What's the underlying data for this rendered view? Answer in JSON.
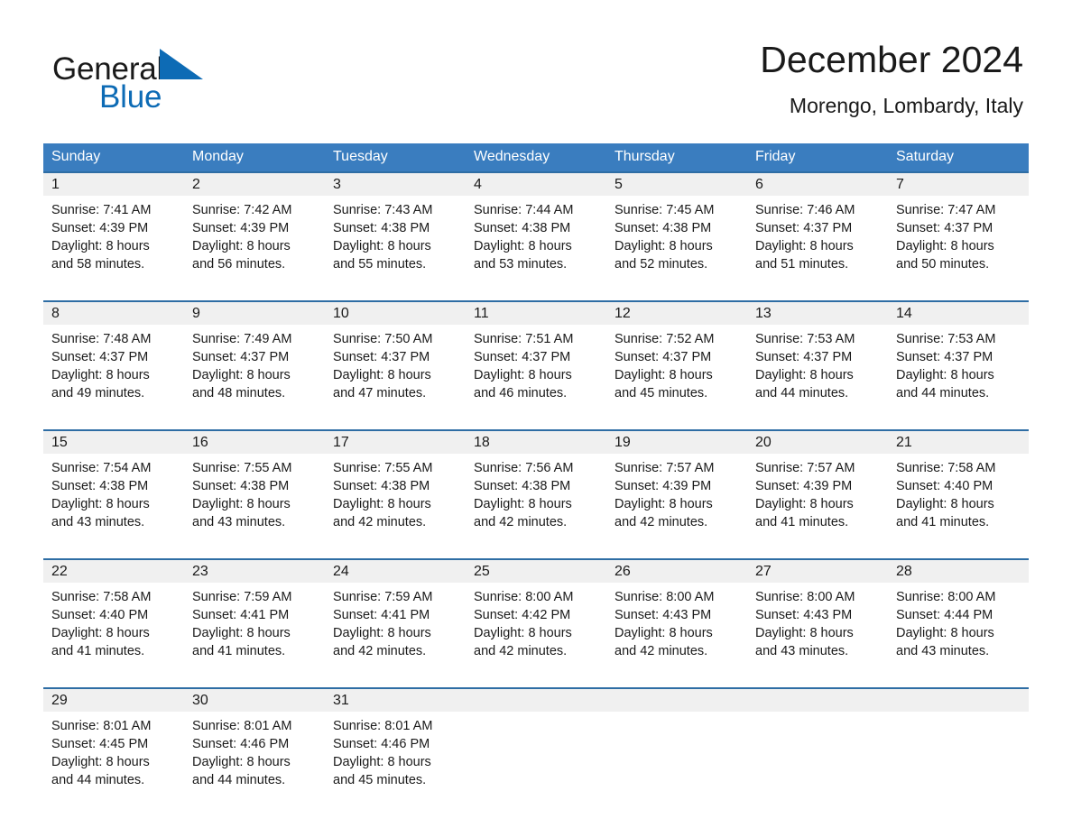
{
  "brand": {
    "name_part1": "General",
    "name_part2": "Blue",
    "triangle_color": "#0d6bb5",
    "text_color": "#1a1a1a"
  },
  "header": {
    "title": "December 2024",
    "subtitle": "Morengo, Lombardy, Italy"
  },
  "theme": {
    "header_bg": "#3a7dbf",
    "header_text": "#ffffff",
    "row_border": "#2e6da4",
    "daynum_bg": "#f0f0f0",
    "body_text": "#1a1a1a",
    "page_bg": "#ffffff"
  },
  "weekdays": [
    "Sunday",
    "Monday",
    "Tuesday",
    "Wednesday",
    "Thursday",
    "Friday",
    "Saturday"
  ],
  "labels": {
    "sunrise_prefix": "Sunrise:",
    "sunset_prefix": "Sunset:",
    "daylight_prefix": "Daylight:"
  },
  "weeks": [
    {
      "days": [
        {
          "day": "1",
          "sunrise": "Sunrise: 7:41 AM",
          "sunset": "Sunset: 4:39 PM",
          "daylight_line1": "Daylight: 8 hours",
          "daylight_line2": "and 58 minutes."
        },
        {
          "day": "2",
          "sunrise": "Sunrise: 7:42 AM",
          "sunset": "Sunset: 4:39 PM",
          "daylight_line1": "Daylight: 8 hours",
          "daylight_line2": "and 56 minutes."
        },
        {
          "day": "3",
          "sunrise": "Sunrise: 7:43 AM",
          "sunset": "Sunset: 4:38 PM",
          "daylight_line1": "Daylight: 8 hours",
          "daylight_line2": "and 55 minutes."
        },
        {
          "day": "4",
          "sunrise": "Sunrise: 7:44 AM",
          "sunset": "Sunset: 4:38 PM",
          "daylight_line1": "Daylight: 8 hours",
          "daylight_line2": "and 53 minutes."
        },
        {
          "day": "5",
          "sunrise": "Sunrise: 7:45 AM",
          "sunset": "Sunset: 4:38 PM",
          "daylight_line1": "Daylight: 8 hours",
          "daylight_line2": "and 52 minutes."
        },
        {
          "day": "6",
          "sunrise": "Sunrise: 7:46 AM",
          "sunset": "Sunset: 4:37 PM",
          "daylight_line1": "Daylight: 8 hours",
          "daylight_line2": "and 51 minutes."
        },
        {
          "day": "7",
          "sunrise": "Sunrise: 7:47 AM",
          "sunset": "Sunset: 4:37 PM",
          "daylight_line1": "Daylight: 8 hours",
          "daylight_line2": "and 50 minutes."
        }
      ]
    },
    {
      "days": [
        {
          "day": "8",
          "sunrise": "Sunrise: 7:48 AM",
          "sunset": "Sunset: 4:37 PM",
          "daylight_line1": "Daylight: 8 hours",
          "daylight_line2": "and 49 minutes."
        },
        {
          "day": "9",
          "sunrise": "Sunrise: 7:49 AM",
          "sunset": "Sunset: 4:37 PM",
          "daylight_line1": "Daylight: 8 hours",
          "daylight_line2": "and 48 minutes."
        },
        {
          "day": "10",
          "sunrise": "Sunrise: 7:50 AM",
          "sunset": "Sunset: 4:37 PM",
          "daylight_line1": "Daylight: 8 hours",
          "daylight_line2": "and 47 minutes."
        },
        {
          "day": "11",
          "sunrise": "Sunrise: 7:51 AM",
          "sunset": "Sunset: 4:37 PM",
          "daylight_line1": "Daylight: 8 hours",
          "daylight_line2": "and 46 minutes."
        },
        {
          "day": "12",
          "sunrise": "Sunrise: 7:52 AM",
          "sunset": "Sunset: 4:37 PM",
          "daylight_line1": "Daylight: 8 hours",
          "daylight_line2": "and 45 minutes."
        },
        {
          "day": "13",
          "sunrise": "Sunrise: 7:53 AM",
          "sunset": "Sunset: 4:37 PM",
          "daylight_line1": "Daylight: 8 hours",
          "daylight_line2": "and 44 minutes."
        },
        {
          "day": "14",
          "sunrise": "Sunrise: 7:53 AM",
          "sunset": "Sunset: 4:37 PM",
          "daylight_line1": "Daylight: 8 hours",
          "daylight_line2": "and 44 minutes."
        }
      ]
    },
    {
      "days": [
        {
          "day": "15",
          "sunrise": "Sunrise: 7:54 AM",
          "sunset": "Sunset: 4:38 PM",
          "daylight_line1": "Daylight: 8 hours",
          "daylight_line2": "and 43 minutes."
        },
        {
          "day": "16",
          "sunrise": "Sunrise: 7:55 AM",
          "sunset": "Sunset: 4:38 PM",
          "daylight_line1": "Daylight: 8 hours",
          "daylight_line2": "and 43 minutes."
        },
        {
          "day": "17",
          "sunrise": "Sunrise: 7:55 AM",
          "sunset": "Sunset: 4:38 PM",
          "daylight_line1": "Daylight: 8 hours",
          "daylight_line2": "and 42 minutes."
        },
        {
          "day": "18",
          "sunrise": "Sunrise: 7:56 AM",
          "sunset": "Sunset: 4:38 PM",
          "daylight_line1": "Daylight: 8 hours",
          "daylight_line2": "and 42 minutes."
        },
        {
          "day": "19",
          "sunrise": "Sunrise: 7:57 AM",
          "sunset": "Sunset: 4:39 PM",
          "daylight_line1": "Daylight: 8 hours",
          "daylight_line2": "and 42 minutes."
        },
        {
          "day": "20",
          "sunrise": "Sunrise: 7:57 AM",
          "sunset": "Sunset: 4:39 PM",
          "daylight_line1": "Daylight: 8 hours",
          "daylight_line2": "and 41 minutes."
        },
        {
          "day": "21",
          "sunrise": "Sunrise: 7:58 AM",
          "sunset": "Sunset: 4:40 PM",
          "daylight_line1": "Daylight: 8 hours",
          "daylight_line2": "and 41 minutes."
        }
      ]
    },
    {
      "days": [
        {
          "day": "22",
          "sunrise": "Sunrise: 7:58 AM",
          "sunset": "Sunset: 4:40 PM",
          "daylight_line1": "Daylight: 8 hours",
          "daylight_line2": "and 41 minutes."
        },
        {
          "day": "23",
          "sunrise": "Sunrise: 7:59 AM",
          "sunset": "Sunset: 4:41 PM",
          "daylight_line1": "Daylight: 8 hours",
          "daylight_line2": "and 41 minutes."
        },
        {
          "day": "24",
          "sunrise": "Sunrise: 7:59 AM",
          "sunset": "Sunset: 4:41 PM",
          "daylight_line1": "Daylight: 8 hours",
          "daylight_line2": "and 42 minutes."
        },
        {
          "day": "25",
          "sunrise": "Sunrise: 8:00 AM",
          "sunset": "Sunset: 4:42 PM",
          "daylight_line1": "Daylight: 8 hours",
          "daylight_line2": "and 42 minutes."
        },
        {
          "day": "26",
          "sunrise": "Sunrise: 8:00 AM",
          "sunset": "Sunset: 4:43 PM",
          "daylight_line1": "Daylight: 8 hours",
          "daylight_line2": "and 42 minutes."
        },
        {
          "day": "27",
          "sunrise": "Sunrise: 8:00 AM",
          "sunset": "Sunset: 4:43 PM",
          "daylight_line1": "Daylight: 8 hours",
          "daylight_line2": "and 43 minutes."
        },
        {
          "day": "28",
          "sunrise": "Sunrise: 8:00 AM",
          "sunset": "Sunset: 4:44 PM",
          "daylight_line1": "Daylight: 8 hours",
          "daylight_line2": "and 43 minutes."
        }
      ]
    },
    {
      "days": [
        {
          "day": "29",
          "sunrise": "Sunrise: 8:01 AM",
          "sunset": "Sunset: 4:45 PM",
          "daylight_line1": "Daylight: 8 hours",
          "daylight_line2": "and 44 minutes."
        },
        {
          "day": "30",
          "sunrise": "Sunrise: 8:01 AM",
          "sunset": "Sunset: 4:46 PM",
          "daylight_line1": "Daylight: 8 hours",
          "daylight_line2": "and 44 minutes."
        },
        {
          "day": "31",
          "sunrise": "Sunrise: 8:01 AM",
          "sunset": "Sunset: 4:46 PM",
          "daylight_line1": "Daylight: 8 hours",
          "daylight_line2": "and 45 minutes."
        },
        {
          "day": "",
          "sunrise": "",
          "sunset": "",
          "daylight_line1": "",
          "daylight_line2": ""
        },
        {
          "day": "",
          "sunrise": "",
          "sunset": "",
          "daylight_line1": "",
          "daylight_line2": ""
        },
        {
          "day": "",
          "sunrise": "",
          "sunset": "",
          "daylight_line1": "",
          "daylight_line2": ""
        },
        {
          "day": "",
          "sunrise": "",
          "sunset": "",
          "daylight_line1": "",
          "daylight_line2": ""
        }
      ]
    }
  ]
}
